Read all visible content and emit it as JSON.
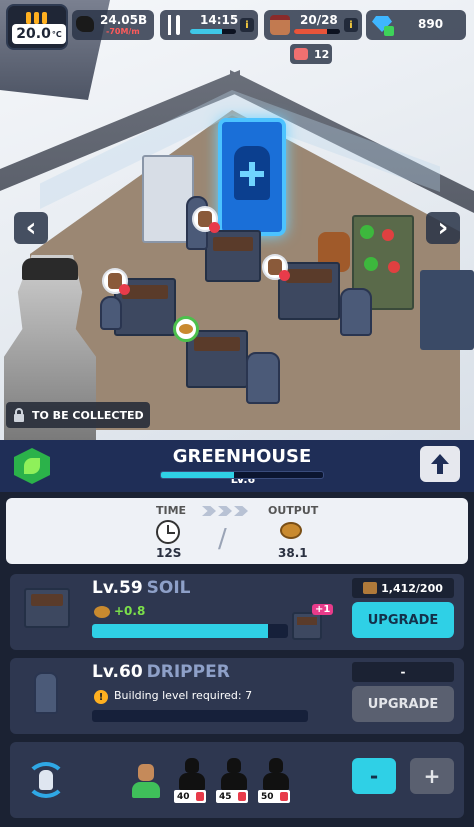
{
  "hud": {
    "temperature": "20.0",
    "temperature_unit": "°C",
    "coal_amount": "24.05B",
    "coal_rate": "-70M/m",
    "food_time": "14:15",
    "workers": "20/28",
    "sick_count": "12",
    "gems": "890",
    "info_glyph": "i"
  },
  "scene": {
    "nav_left": "‹",
    "nav_right": "›",
    "collect_label": "TO BE COLLECTED"
  },
  "building": {
    "name": "GREENHOUSE",
    "level": "LV.6",
    "progress": 0.45
  },
  "production": {
    "time_label": "TIME",
    "output_label": "OUTPUT",
    "time_value": "12S",
    "output_value": "38.1",
    "separator": "/"
  },
  "upgrades": [
    {
      "level": "Lv.59",
      "name": "SOIL",
      "bonus": "+0.8",
      "badge": "+1",
      "cost": "1,412/200",
      "button": "UPGRADE",
      "progress": 0.9
    },
    {
      "level": "Lv.60",
      "name": "DRIPPER",
      "requirement": "Building level required: 7",
      "cost": "-",
      "button": "UPGRADE",
      "progress": 0.0
    }
  ],
  "staff": {
    "slots": [
      {
        "state": "hired"
      },
      {
        "state": "locked",
        "unlock_level": "40"
      },
      {
        "state": "locked",
        "unlock_level": "45"
      },
      {
        "state": "locked",
        "unlock_level": "50"
      }
    ],
    "minus_label": "-",
    "plus_label": "+"
  },
  "colors": {
    "accent_cyan": "#2fd0e6",
    "button_gray": "#5a6070",
    "bonus_green": "#7be04a",
    "badge_pink": "#e83b8a"
  }
}
